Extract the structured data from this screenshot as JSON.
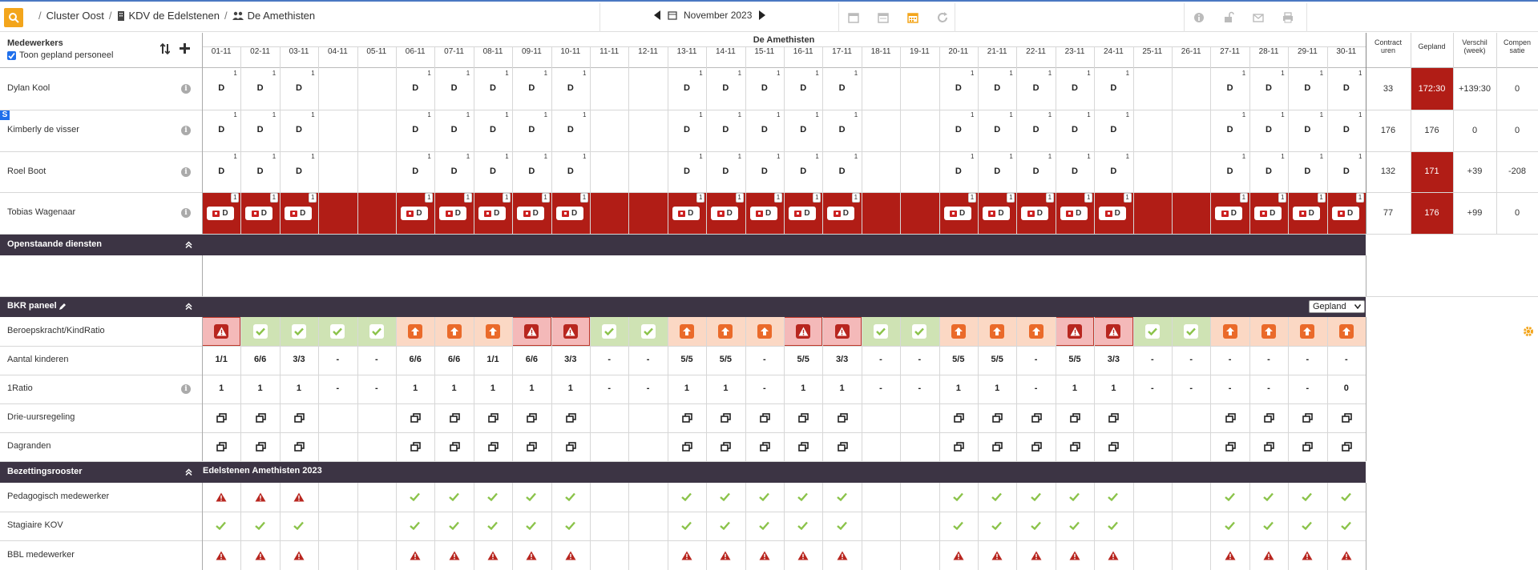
{
  "topbar": {
    "breadcrumb": [
      {
        "label": "Cluster Oost",
        "icon": "none"
      },
      {
        "label": "KDV de Edelstenen",
        "icon": "building-icon"
      },
      {
        "label": "De Amethisten",
        "icon": "users-icon"
      }
    ],
    "month_label": "November 2023",
    "tools_left": [
      "calendar-icon",
      "calendar-week-icon",
      "calendar-month-icon",
      "refresh-icon"
    ],
    "tools_right": [
      "info-icon",
      "unlock-icon",
      "envelope-icon",
      "print-icon"
    ],
    "active_tool": "calendar-month-icon",
    "accent_color": "#f3a51b"
  },
  "header": {
    "staff_title": "Medewerkers",
    "show_planned_label": "Toon gepland personeel",
    "group_name": "De Amethisten",
    "summary_headers": [
      {
        "label": "Contract uren",
        "key": "contract"
      },
      {
        "label": "Gepland",
        "key": "gepland"
      },
      {
        "label": "Verschil (week)",
        "key": "verschil"
      },
      {
        "label": "Compen satie",
        "key": "compensatie"
      }
    ]
  },
  "dates": [
    "01-11",
    "02-11",
    "03-11",
    "04-11",
    "05-11",
    "06-11",
    "07-11",
    "08-11",
    "09-11",
    "10-11",
    "11-11",
    "12-11",
    "13-11",
    "14-11",
    "15-11",
    "16-11",
    "17-11",
    "18-11",
    "19-11",
    "20-11",
    "21-11",
    "22-11",
    "23-11",
    "24-11",
    "25-11",
    "26-11",
    "27-11",
    "28-11",
    "29-11",
    "30-11"
  ],
  "work_days": [
    0,
    1,
    2,
    5,
    6,
    7,
    8,
    9,
    12,
    13,
    14,
    15,
    16,
    19,
    20,
    21,
    22,
    23,
    26,
    27,
    28,
    29
  ],
  "employees": [
    {
      "name": "Dylan Kool",
      "shift_code": "D",
      "count": "1",
      "sick": false,
      "days": [
        0,
        1,
        2,
        5,
        6,
        7,
        8,
        9,
        12,
        13,
        14,
        15,
        16,
        19,
        20,
        21,
        22,
        23,
        26,
        27,
        28,
        29
      ],
      "contract": "33",
      "gepland": "172:30",
      "gepland_alert": true,
      "verschil": "+139:30",
      "compensatie": "0"
    },
    {
      "name": "Kimberly de visser",
      "shift_code": "D",
      "count": "1",
      "sick": false,
      "marker": "S",
      "days": [
        0,
        1,
        2,
        5,
        6,
        7,
        8,
        9,
        12,
        13,
        14,
        15,
        16,
        19,
        20,
        21,
        22,
        23,
        26,
        27,
        28,
        29
      ],
      "contract": "176",
      "gepland": "176",
      "gepland_alert": false,
      "verschil": "0",
      "compensatie": "0"
    },
    {
      "name": "Roel Boot",
      "shift_code": "D",
      "count": "1",
      "sick": false,
      "days": [
        0,
        1,
        2,
        5,
        6,
        7,
        8,
        9,
        12,
        13,
        14,
        15,
        16,
        19,
        20,
        21,
        22,
        23,
        26,
        27,
        28,
        29
      ],
      "contract": "132",
      "gepland": "171",
      "gepland_alert": true,
      "verschil": "+39",
      "compensatie": "-208"
    },
    {
      "name": "Tobias Wagenaar",
      "shift_code": "D",
      "count": "1",
      "sick": true,
      "days": [
        0,
        1,
        2,
        5,
        6,
        7,
        8,
        9,
        12,
        13,
        14,
        15,
        16,
        19,
        20,
        21,
        22,
        23,
        26,
        27,
        28,
        29
      ],
      "contract": "77",
      "gepland": "176",
      "gepland_alert": true,
      "verschil": "+99",
      "compensatie": "0"
    }
  ],
  "open_services": {
    "title": "Openstaande diensten"
  },
  "bkr": {
    "title": "BKR paneel",
    "select_value": "Gepland",
    "rows": {
      "ratio_label": "Beroepskracht/KindRatio",
      "ratio_status": [
        "warn",
        "ok",
        "ok",
        "ok",
        "ok",
        "up",
        "up",
        "up",
        "warn",
        "warn",
        "ok",
        "ok",
        "up",
        "up",
        "up",
        "warn",
        "warn",
        "ok",
        "ok",
        "up",
        "up",
        "up",
        "warn",
        "warn",
        "ok",
        "ok",
        "up",
        "up",
        "up",
        "up"
      ],
      "kinderen_label": "Aantal kinderen",
      "kinderen": [
        "1/1",
        "6/6",
        "3/3",
        "-",
        "-",
        "6/6",
        "6/6",
        "1/1",
        "6/6",
        "3/3",
        "-",
        "-",
        "5/5",
        "5/5",
        "-",
        "5/5",
        "3/3",
        "-",
        "-",
        "5/5",
        "5/5",
        "-",
        "5/5",
        "3/3",
        "-",
        "-",
        "-",
        "-",
        "-",
        "-"
      ],
      "ratio1_label": "1Ratio",
      "ratio1": [
        "1",
        "1",
        "1",
        "-",
        "-",
        "1",
        "1",
        "1",
        "1",
        "1",
        "-",
        "-",
        "1",
        "1",
        "-",
        "1",
        "1",
        "-",
        "-",
        "1",
        "1",
        "-",
        "1",
        "1",
        "-",
        "-",
        "-",
        "-",
        "-",
        "0"
      ],
      "drie_label": "Drie-uursregeling",
      "drie_days": [
        0,
        1,
        2,
        5,
        6,
        7,
        8,
        9,
        12,
        13,
        14,
        15,
        16,
        19,
        20,
        21,
        22,
        23,
        26,
        27,
        28,
        29
      ],
      "dagranden_label": "Dagranden",
      "dagranden_days": [
        0,
        1,
        2,
        5,
        6,
        7,
        8,
        9,
        12,
        13,
        14,
        15,
        16,
        19,
        20,
        21,
        22,
        23,
        26,
        27,
        28,
        29
      ]
    }
  },
  "bezetting": {
    "title": "Bezettingsrooster",
    "subtitle": "Edelstenen Amethisten 2023",
    "rows": [
      {
        "label": "Pedagogisch medewerker",
        "status": [
          "warn",
          "warn",
          "warn",
          null,
          null,
          "ok",
          "ok",
          "ok",
          "ok",
          "ok",
          null,
          null,
          "ok",
          "ok",
          "ok",
          "ok",
          "ok",
          null,
          null,
          "ok",
          "ok",
          "ok",
          "ok",
          "ok",
          null,
          null,
          "ok",
          "ok",
          "ok",
          "ok"
        ]
      },
      {
        "label": "Stagiaire KOV",
        "status": [
          "ok",
          "ok",
          "ok",
          null,
          null,
          "ok",
          "ok",
          "ok",
          "ok",
          "ok",
          null,
          null,
          "ok",
          "ok",
          "ok",
          "ok",
          "ok",
          null,
          null,
          "ok",
          "ok",
          "ok",
          "ok",
          "ok",
          null,
          null,
          "ok",
          "ok",
          "ok",
          "ok"
        ]
      },
      {
        "label": "BBL medewerker",
        "status": [
          "warn",
          "warn",
          "warn",
          null,
          null,
          "warn",
          "warn",
          "warn",
          "warn",
          "warn",
          null,
          null,
          "warn",
          "warn",
          "warn",
          "warn",
          "warn",
          null,
          null,
          "warn",
          "warn",
          "warn",
          "warn",
          "warn",
          null,
          null,
          "warn",
          "warn",
          "warn",
          "warn"
        ]
      }
    ]
  },
  "colors": {
    "dark_band": "#3c3444",
    "sick_red": "#b11d16",
    "ok_bg": "#cfe3b4",
    "ok_icon": "#8bc34a",
    "up_bg": "#fbd8c4",
    "up_icon": "#ea6a2a",
    "warn_bg": "#f4b9b9",
    "warn_icon": "#b8261f"
  }
}
